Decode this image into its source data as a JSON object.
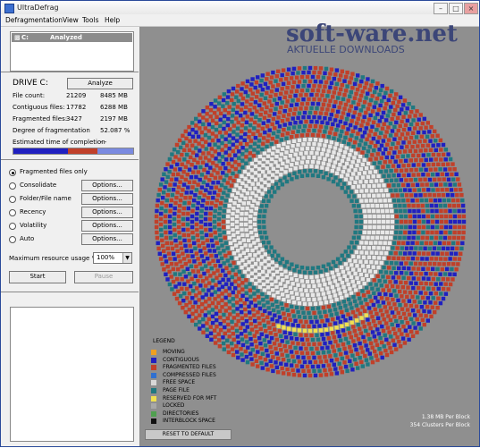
{
  "window": {
    "title": "UltraDefrag"
  },
  "menu": [
    "Defragmentation",
    "View",
    "Tools",
    "Help"
  ],
  "drive_list": {
    "drive": "C:",
    "status": "Analyzed"
  },
  "drive_info": {
    "title": "DRIVE C:",
    "analyze_label": "Analyze",
    "stats": [
      {
        "label": "File count:",
        "v1": "21209",
        "v2": "8485 MB"
      },
      {
        "label": "Contiguous files:",
        "v1": "17782",
        "v2": "6288 MB"
      },
      {
        "label": "Fragmented files:",
        "v1": "3427",
        "v2": "2197 MB"
      },
      {
        "label": "Degree of fragmentation",
        "v1": "",
        "v2": "52.087 %"
      },
      {
        "label": "Estimated time of completion",
        "v1": "",
        "v2": "- -"
      }
    ],
    "fragmentation_degree_pct": 52.087
  },
  "options": [
    {
      "label": "Fragmented files only",
      "checked": true,
      "has_options": false
    },
    {
      "label": "Consolidate",
      "checked": false,
      "has_options": true
    },
    {
      "label": "Folder/File name",
      "checked": false,
      "has_options": true
    },
    {
      "label": "Recency",
      "checked": false,
      "has_options": true
    },
    {
      "label": "Volatility",
      "checked": false,
      "has_options": true
    },
    {
      "label": "Auto",
      "checked": false,
      "has_options": true
    }
  ],
  "options_label": "Options...",
  "resource": {
    "label": "Maximum resource usage %",
    "value": "100%"
  },
  "start_label": "Start",
  "pause_label": "Pause",
  "legend": {
    "title": "LEGEND",
    "items": [
      {
        "label": "MOVING",
        "color": "#f0a020"
      },
      {
        "label": "CONTIGUOUS",
        "color": "#2020c0"
      },
      {
        "label": "FRAGMENTED FILES",
        "color": "#c0402a"
      },
      {
        "label": "COMPRESSED FILES",
        "color": "#3070d0"
      },
      {
        "label": "FREE SPACE",
        "color": "#d8d8d8"
      },
      {
        "label": "PAGE FILE",
        "color": "#207880"
      },
      {
        "label": "RESERVED FOR MFT",
        "color": "#f0e050"
      },
      {
        "label": "LOCKED",
        "color": "#a8a8a8"
      },
      {
        "label": "DIRECTORIES",
        "color": "#50a050"
      },
      {
        "label": "INTERBLOCK SPACE",
        "color": "#101010"
      }
    ]
  },
  "reset_label": "RESET TO DEFAULT",
  "block_info": {
    "line1": "1.38 MB Per Block",
    "line2": "354 Clusters Per Block"
  },
  "watermark": {
    "brand": "soft-ware.net",
    "tagline": "AKTUELLE DOWNLOADS"
  },
  "colors": {
    "fragmented": "#c0402a",
    "contiguous": "#2020c0",
    "page_file": "#207880",
    "free": "#e8e8e8",
    "moving": "#f0e050",
    "panel": "#8f8f8f"
  }
}
